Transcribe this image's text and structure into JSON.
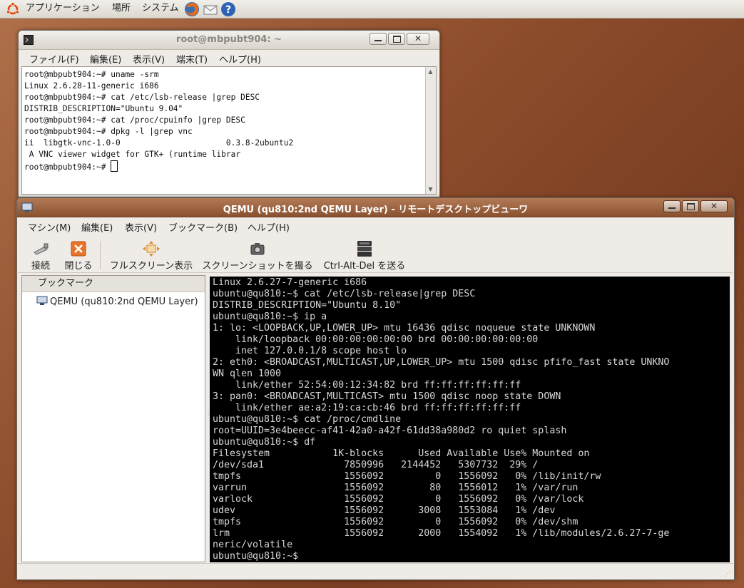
{
  "top_panel": {
    "applications": "アプリケーション",
    "places": "場所",
    "system": "システム"
  },
  "terminal": {
    "title": "root@mbpubt904: ~",
    "menu": [
      "ファイル(F)",
      "編集(E)",
      "表示(V)",
      "端末(T)",
      "ヘルプ(H)"
    ],
    "lines": [
      "root@mbpubt904:~# uname -srm",
      "Linux 2.6.28-11-generic i686",
      "root@mbpubt904:~# cat /etc/lsb-release |grep DESC",
      "DISTRIB_DESCRIPTION=\"Ubuntu 9.04\"",
      "root@mbpubt904:~# cat /proc/cpuinfo |grep DESC",
      "root@mbpubt904:~# dpkg -l |grep vnc",
      "ii  libgtk-vnc-1.0-0                      0.3.8-2ubuntu2",
      " A VNC viewer widget for GTK+ (runtime librar"
    ],
    "prompt": "root@mbpubt904:~# "
  },
  "qemu": {
    "title": "QEMU (qu810:2nd QEMU Layer) - リモートデスクトップビューワ",
    "menu": [
      "マシン(M)",
      "編集(E)",
      "表示(V)",
      "ブックマーク(B)",
      "ヘルプ(H)"
    ],
    "toolbar": {
      "connect": "接続",
      "close": "閉じる",
      "fullscreen": "フルスクリーン表示",
      "screenshot": "スクリーンショットを撮る",
      "ctrl_alt_del": "Ctrl-Alt-Del を送る"
    },
    "bookmarks_header": "ブックマーク",
    "bookmark_item": "QEMU (qu810:2nd QEMU Layer)",
    "screen_lines": [
      "Linux 2.6.27-7-generic i686",
      "ubuntu@qu810:~$ cat /etc/lsb-release|grep DESC",
      "DISTRIB_DESCRIPTION=\"Ubuntu 8.10\"",
      "ubuntu@qu810:~$ ip a",
      "1: lo: <LOOPBACK,UP,LOWER_UP> mtu 16436 qdisc noqueue state UNKNOWN",
      "    link/loopback 00:00:00:00:00:00 brd 00:00:00:00:00:00",
      "    inet 127.0.0.1/8 scope host lo",
      "2: eth0: <BROADCAST,MULTICAST,UP,LOWER_UP> mtu 1500 qdisc pfifo_fast state UNKNO",
      "WN qlen 1000",
      "    link/ether 52:54:00:12:34:82 brd ff:ff:ff:ff:ff:ff",
      "3: pan0: <BROADCAST,MULTICAST> mtu 1500 qdisc noop state DOWN",
      "    link/ether ae:a2:19:ca:cb:46 brd ff:ff:ff:ff:ff:ff",
      "ubuntu@qu810:~$ cat /proc/cmdline",
      "root=UUID=3e4beecc-af41-42a0-a42f-61dd38a980d2 ro quiet splash",
      "ubuntu@qu810:~$ df",
      "Filesystem           1K-blocks      Used Available Use% Mounted on",
      "/dev/sda1              7850996   2144452   5307732  29% /",
      "tmpfs                  1556092         0   1556092   0% /lib/init/rw",
      "varrun                 1556092        80   1556012   1% /var/run",
      "varlock                1556092         0   1556092   0% /var/lock",
      "udev                   1556092      3008   1553084   1% /dev",
      "tmpfs                  1556092         0   1556092   0% /dev/shm",
      "lrm                    1556092      2000   1554092   1% /lib/modules/2.6.27-7-ge",
      "neric/volatile",
      "ubuntu@qu810:~$"
    ]
  }
}
